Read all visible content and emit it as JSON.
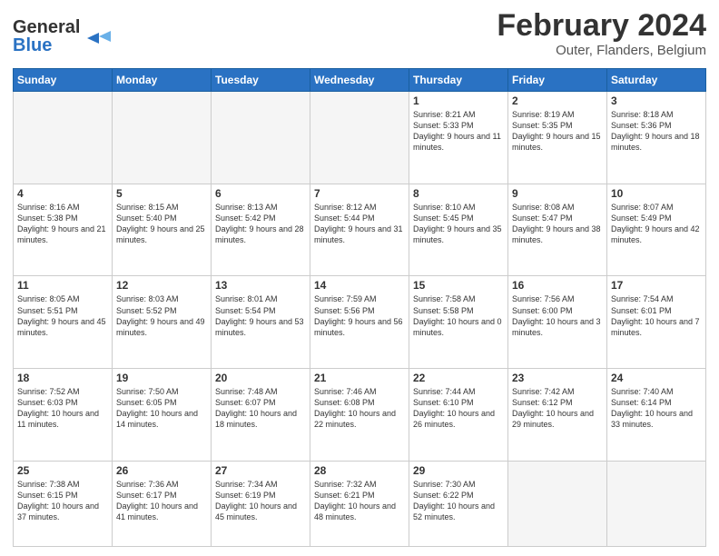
{
  "header": {
    "logo_line1": "General",
    "logo_line2": "Blue",
    "month": "February 2024",
    "location": "Outer, Flanders, Belgium"
  },
  "days_of_week": [
    "Sunday",
    "Monday",
    "Tuesday",
    "Wednesday",
    "Thursday",
    "Friday",
    "Saturday"
  ],
  "weeks": [
    [
      {
        "day": "",
        "info": ""
      },
      {
        "day": "",
        "info": ""
      },
      {
        "day": "",
        "info": ""
      },
      {
        "day": "",
        "info": ""
      },
      {
        "day": "1",
        "info": "Sunrise: 8:21 AM\nSunset: 5:33 PM\nDaylight: 9 hours\nand 11 minutes."
      },
      {
        "day": "2",
        "info": "Sunrise: 8:19 AM\nSunset: 5:35 PM\nDaylight: 9 hours\nand 15 minutes."
      },
      {
        "day": "3",
        "info": "Sunrise: 8:18 AM\nSunset: 5:36 PM\nDaylight: 9 hours\nand 18 minutes."
      }
    ],
    [
      {
        "day": "4",
        "info": "Sunrise: 8:16 AM\nSunset: 5:38 PM\nDaylight: 9 hours\nand 21 minutes."
      },
      {
        "day": "5",
        "info": "Sunrise: 8:15 AM\nSunset: 5:40 PM\nDaylight: 9 hours\nand 25 minutes."
      },
      {
        "day": "6",
        "info": "Sunrise: 8:13 AM\nSunset: 5:42 PM\nDaylight: 9 hours\nand 28 minutes."
      },
      {
        "day": "7",
        "info": "Sunrise: 8:12 AM\nSunset: 5:44 PM\nDaylight: 9 hours\nand 31 minutes."
      },
      {
        "day": "8",
        "info": "Sunrise: 8:10 AM\nSunset: 5:45 PM\nDaylight: 9 hours\nand 35 minutes."
      },
      {
        "day": "9",
        "info": "Sunrise: 8:08 AM\nSunset: 5:47 PM\nDaylight: 9 hours\nand 38 minutes."
      },
      {
        "day": "10",
        "info": "Sunrise: 8:07 AM\nSunset: 5:49 PM\nDaylight: 9 hours\nand 42 minutes."
      }
    ],
    [
      {
        "day": "11",
        "info": "Sunrise: 8:05 AM\nSunset: 5:51 PM\nDaylight: 9 hours\nand 45 minutes."
      },
      {
        "day": "12",
        "info": "Sunrise: 8:03 AM\nSunset: 5:52 PM\nDaylight: 9 hours\nand 49 minutes."
      },
      {
        "day": "13",
        "info": "Sunrise: 8:01 AM\nSunset: 5:54 PM\nDaylight: 9 hours\nand 53 minutes."
      },
      {
        "day": "14",
        "info": "Sunrise: 7:59 AM\nSunset: 5:56 PM\nDaylight: 9 hours\nand 56 minutes."
      },
      {
        "day": "15",
        "info": "Sunrise: 7:58 AM\nSunset: 5:58 PM\nDaylight: 10 hours\nand 0 minutes."
      },
      {
        "day": "16",
        "info": "Sunrise: 7:56 AM\nSunset: 6:00 PM\nDaylight: 10 hours\nand 3 minutes."
      },
      {
        "day": "17",
        "info": "Sunrise: 7:54 AM\nSunset: 6:01 PM\nDaylight: 10 hours\nand 7 minutes."
      }
    ],
    [
      {
        "day": "18",
        "info": "Sunrise: 7:52 AM\nSunset: 6:03 PM\nDaylight: 10 hours\nand 11 minutes."
      },
      {
        "day": "19",
        "info": "Sunrise: 7:50 AM\nSunset: 6:05 PM\nDaylight: 10 hours\nand 14 minutes."
      },
      {
        "day": "20",
        "info": "Sunrise: 7:48 AM\nSunset: 6:07 PM\nDaylight: 10 hours\nand 18 minutes."
      },
      {
        "day": "21",
        "info": "Sunrise: 7:46 AM\nSunset: 6:08 PM\nDaylight: 10 hours\nand 22 minutes."
      },
      {
        "day": "22",
        "info": "Sunrise: 7:44 AM\nSunset: 6:10 PM\nDaylight: 10 hours\nand 26 minutes."
      },
      {
        "day": "23",
        "info": "Sunrise: 7:42 AM\nSunset: 6:12 PM\nDaylight: 10 hours\nand 29 minutes."
      },
      {
        "day": "24",
        "info": "Sunrise: 7:40 AM\nSunset: 6:14 PM\nDaylight: 10 hours\nand 33 minutes."
      }
    ],
    [
      {
        "day": "25",
        "info": "Sunrise: 7:38 AM\nSunset: 6:15 PM\nDaylight: 10 hours\nand 37 minutes."
      },
      {
        "day": "26",
        "info": "Sunrise: 7:36 AM\nSunset: 6:17 PM\nDaylight: 10 hours\nand 41 minutes."
      },
      {
        "day": "27",
        "info": "Sunrise: 7:34 AM\nSunset: 6:19 PM\nDaylight: 10 hours\nand 45 minutes."
      },
      {
        "day": "28",
        "info": "Sunrise: 7:32 AM\nSunset: 6:21 PM\nDaylight: 10 hours\nand 48 minutes."
      },
      {
        "day": "29",
        "info": "Sunrise: 7:30 AM\nSunset: 6:22 PM\nDaylight: 10 hours\nand 52 minutes."
      },
      {
        "day": "",
        "info": ""
      },
      {
        "day": "",
        "info": ""
      }
    ]
  ]
}
